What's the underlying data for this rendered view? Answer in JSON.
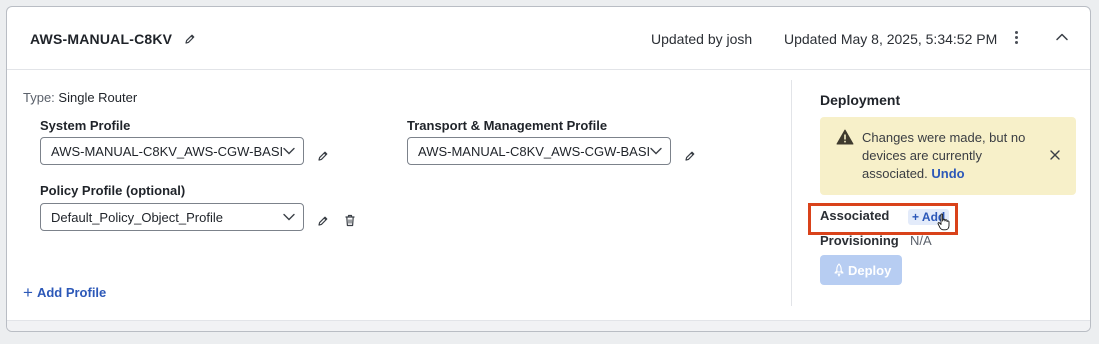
{
  "header": {
    "title": "AWS-MANUAL-C8KV",
    "updated_by": "Updated by josh",
    "updated_at": "Updated May 8, 2025, 5:34:52 PM"
  },
  "config": {
    "type_key": "Type:",
    "type_value": "Single Router",
    "system_profile": {
      "label": "System Profile",
      "value": "AWS-MANUAL-C8KV_AWS-CGW-BASI"
    },
    "transport_profile": {
      "label": "Transport & Management Profile",
      "value": "AWS-MANUAL-C8KV_AWS-CGW-BASI"
    },
    "policy_profile": {
      "label": "Policy Profile (optional)",
      "value": "Default_Policy_Object_Profile"
    },
    "add_profile_label": "Add Profile"
  },
  "deployment": {
    "title": "Deployment",
    "alert_message": "Changes were made, but no devices are currently associated.",
    "undo_label": "Undo",
    "associated_label": "Associated",
    "add_label": "Add",
    "provisioning_label": "Provisioning",
    "provisioning_value": "N/A",
    "deploy_label": "Deploy"
  },
  "colors": {
    "accent": "#2c58b8",
    "alert_bg": "#f7f0c9",
    "highlight": "#d9421a",
    "deploy_disabled": "#b7cdf2"
  },
  "icons": [
    "pencil-icon",
    "kebab-icon",
    "chevron-up-icon",
    "chevron-down-icon",
    "trash-icon",
    "warning-icon",
    "close-icon",
    "plus-icon",
    "rocket-icon",
    "hand-cursor-icon"
  ]
}
